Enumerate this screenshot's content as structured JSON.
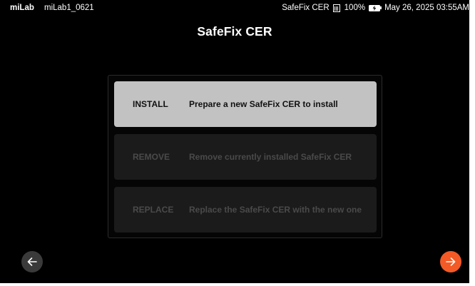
{
  "statusbar": {
    "brand": "miLab",
    "device_name": "miLab1_0621",
    "cartridge": "SafeFix CER",
    "battery_percent": "100%",
    "datetime": "May 26, 2025 03:55AM",
    "icons": [
      "sim-card-icon",
      "battery-charging-icon"
    ]
  },
  "page": {
    "title": "SafeFix CER"
  },
  "options": [
    {
      "label": "INSTALL",
      "description": "Prepare a new SafeFix CER to install",
      "state": "enabled"
    },
    {
      "label": "REMOVE",
      "description": "Remove currently installed SafeFix CER",
      "state": "disabled"
    },
    {
      "label": "REPLACE",
      "description": "Replace the SafeFix CER with the new one",
      "state": "disabled"
    }
  ],
  "navigation": {
    "back_icon": "arrow-left-icon",
    "next_icon": "arrow-right-icon"
  },
  "colors": {
    "background": "#000000",
    "selected_option": "#c2c2c2",
    "disabled_option": "#1b1b1b",
    "disabled_text": "#4a4a4a",
    "next_button": "#f35a26",
    "back_button": "#3a3a3a"
  }
}
